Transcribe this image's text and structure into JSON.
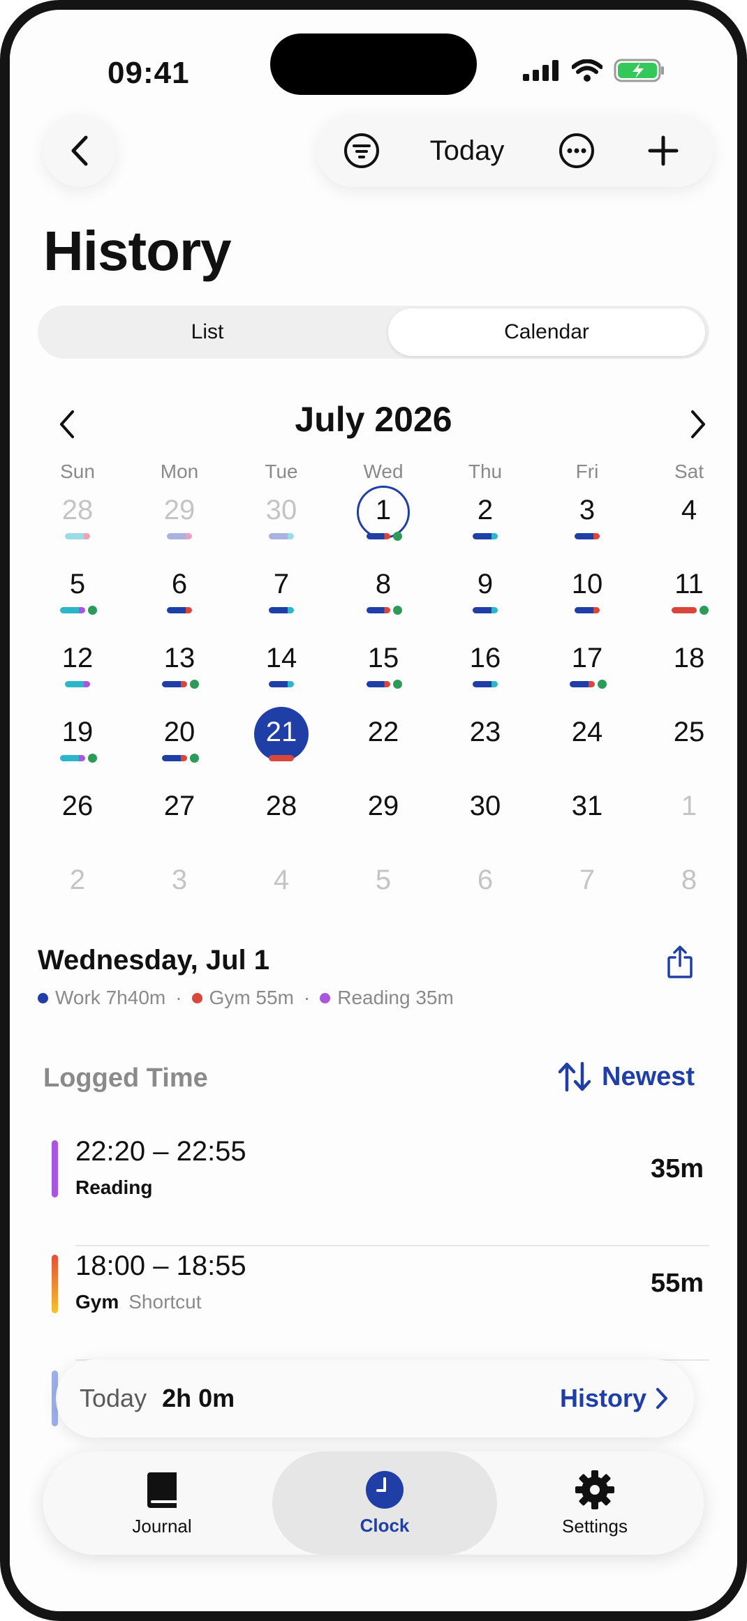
{
  "status_bar": {
    "time": "09:41"
  },
  "toolbar": {
    "today_label": "Today"
  },
  "page": {
    "title": "History"
  },
  "segmented": {
    "list_label": "List",
    "calendar_label": "Calendar"
  },
  "calendar": {
    "month_title": "July 2026",
    "weekdays": [
      "Sun",
      "Mon",
      "Tue",
      "Wed",
      "Thu",
      "Fri",
      "Sat"
    ],
    "weeks": [
      [
        "28",
        "29",
        "30",
        "1",
        "2",
        "3",
        "4"
      ],
      [
        "5",
        "6",
        "7",
        "8",
        "9",
        "10",
        "11"
      ],
      [
        "12",
        "13",
        "14",
        "15",
        "16",
        "17",
        "18"
      ],
      [
        "19",
        "20",
        "21",
        "22",
        "23",
        "24",
        "25"
      ],
      [
        "26",
        "27",
        "28",
        "29",
        "30",
        "31",
        "1"
      ],
      [
        "2",
        "3",
        "4",
        "5",
        "6",
        "7",
        "8"
      ]
    ],
    "selected_day": "1",
    "today": "21"
  },
  "day_detail": {
    "heading": "Wednesday, Jul 1",
    "legend": [
      {
        "label": "Work 7h40m",
        "color": "#1f3fa6"
      },
      {
        "label": "Gym 55m",
        "color": "#d9463b"
      },
      {
        "label": "Reading 35m",
        "color": "#a855e0"
      }
    ]
  },
  "logged": {
    "section_title": "Logged Time",
    "sort_label": "Newest",
    "entries": [
      {
        "time": "22:20 – 22:55",
        "name": "Reading",
        "tag": "",
        "duration": "35m",
        "color": "#a855e0"
      },
      {
        "time": "18:00 – 18:55",
        "name": "Gym",
        "tag": "Shortcut",
        "duration": "55m",
        "color": "#e2503a"
      }
    ]
  },
  "summary_bar": {
    "label": "Today",
    "total": "2h 0m",
    "link": "History"
  },
  "tabbar": {
    "journal": "Journal",
    "clock": "Clock",
    "settings": "Settings"
  },
  "colors": {
    "accent": "#1f3fa6",
    "work": "#1f3fa6",
    "gym": "#d9463b",
    "reading": "#a855e0",
    "teal": "#2db5c9",
    "green": "#2e9a5a"
  }
}
